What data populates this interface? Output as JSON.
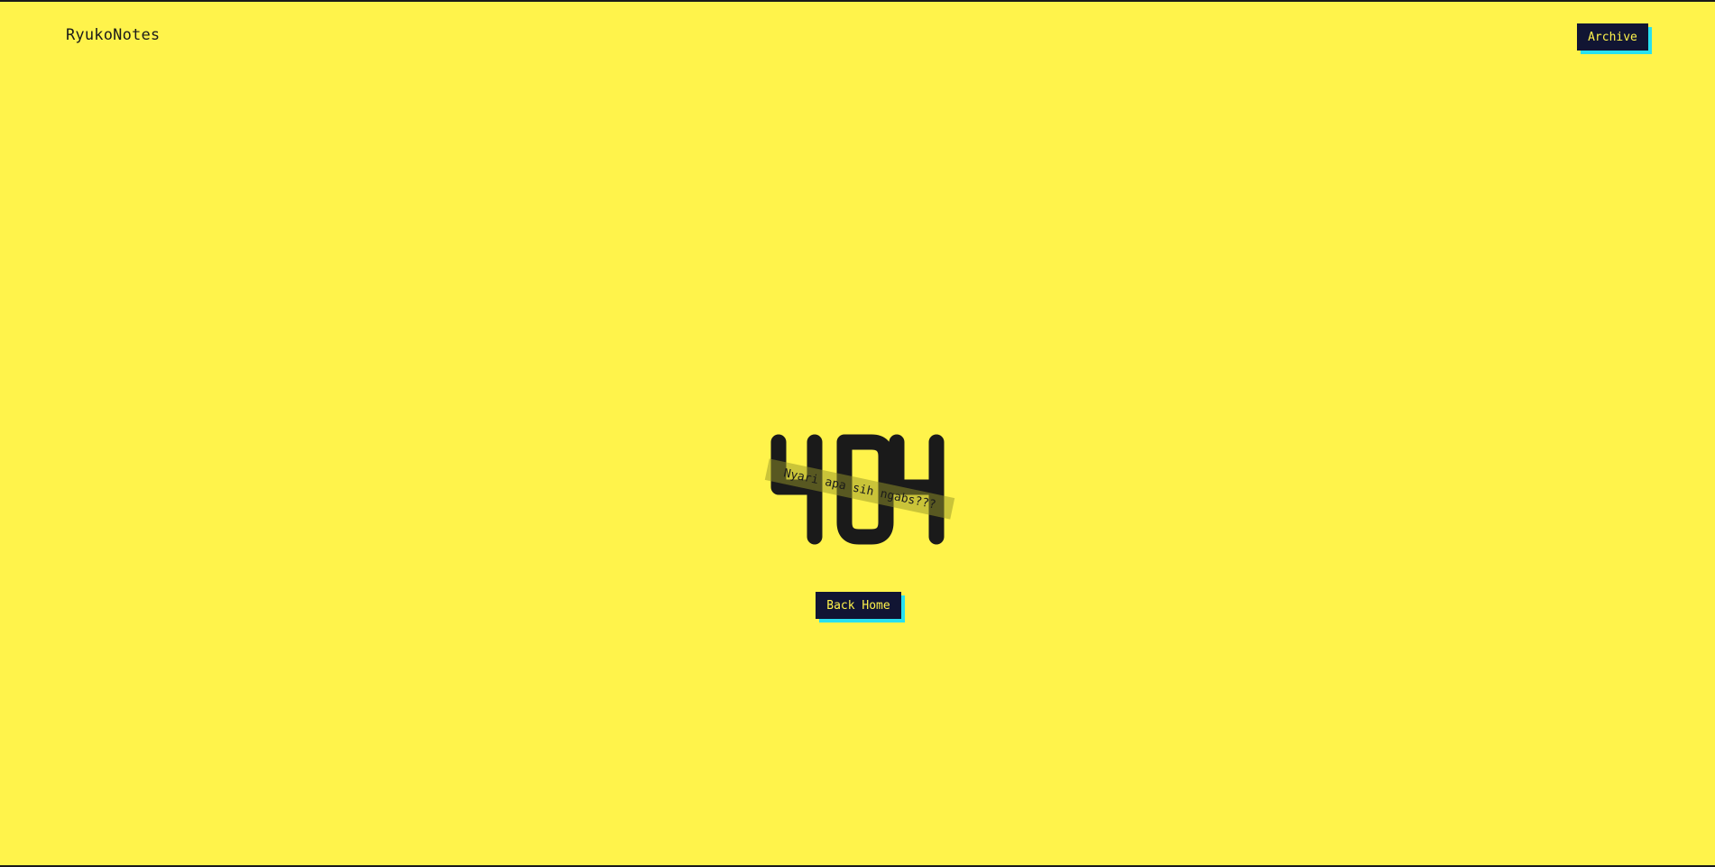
{
  "header": {
    "brand": "RyukoNotes",
    "archive_label": "Archive"
  },
  "error": {
    "code": "404",
    "tagline": "Nyari apa sih ngabs???"
  },
  "actions": {
    "back_home_label": "Back Home"
  },
  "colors": {
    "background": "#fff34b",
    "button_bg": "#111533",
    "button_text": "#fff34b",
    "button_shadow": "#28e0f0",
    "text": "#1a1a1a"
  }
}
